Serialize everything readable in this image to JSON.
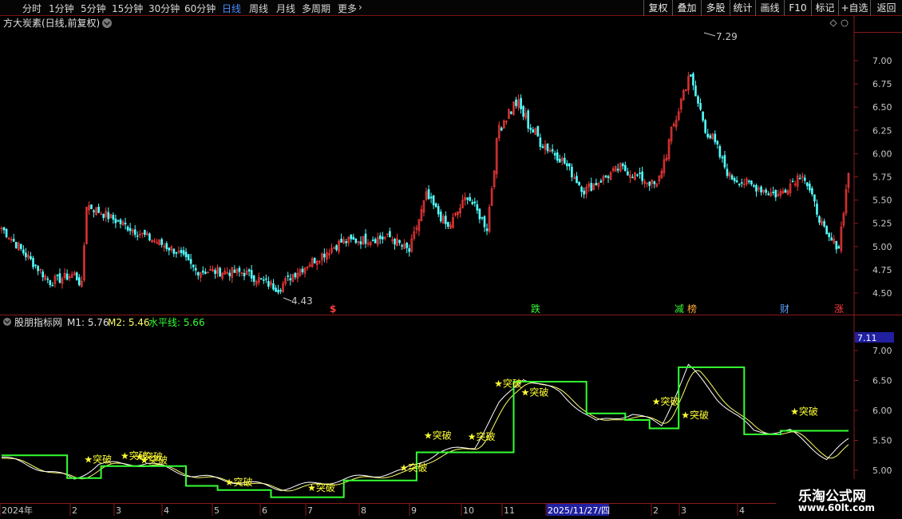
{
  "toolbar": {
    "timeframes": [
      "分时",
      "1分钟",
      "5分钟",
      "15分钟",
      "30分钟",
      "60分钟",
      "日线",
      "周线",
      "月线",
      "多周期",
      "更多"
    ],
    "active_timeframe": "日线",
    "more_chevron": "›",
    "right_buttons": [
      "复权",
      "叠加",
      "多股",
      "统计",
      "画线",
      "F10",
      "标记",
      "+自选",
      "返回"
    ]
  },
  "colors": {
    "up": "#ff3c3c",
    "down": "#54ffff",
    "ma_white": "#ffffff",
    "ma_yellow": "#ffff66",
    "level_green": "#33ff33",
    "signal_star": "#ffff33",
    "border": "#8b1a1a",
    "axis_text": "#c8c8c8",
    "highlight": "#2020a0"
  },
  "main_panel": {
    "title": "方大炭素(日线,前复权)",
    "high_label": "7.29",
    "low_label": "4.43",
    "price_ticks": [
      "7.00",
      "6.75",
      "6.50",
      "6.25",
      "6.00",
      "5.75",
      "5.50",
      "5.25",
      "5.00",
      "4.75",
      "4.50"
    ],
    "event_markers": [
      {
        "label": "$",
        "color": "#ff3c3c"
      },
      {
        "label": "跌",
        "color": "#33ff33"
      },
      {
        "label": "减",
        "color": "#33ff33"
      },
      {
        "label": "榜",
        "color": "#ffaa33"
      },
      {
        "label": "财",
        "color": "#5aa0ff"
      },
      {
        "label": "涨",
        "color": "#ff3c3c"
      }
    ]
  },
  "indicator_panel": {
    "name": "股朋指标网",
    "m1_label": "M1: 5.76",
    "m2_label": "M2: 5.46",
    "level_label": "水平线: 5.66",
    "current_value": "7.11",
    "ticks": [
      "7.00",
      "6.50",
      "6.00",
      "5.50",
      "5.00"
    ],
    "signal_text": "★突破",
    "signal_prices": [
      5.18,
      5.24,
      5.23,
      5.17,
      4.8,
      4.71,
      5.04,
      5.58,
      5.56,
      6.45,
      6.3,
      6.15,
      5.92,
      5.98
    ]
  },
  "date_axis": {
    "labels": [
      "2024年",
      "2",
      "3",
      "4",
      "5",
      "6",
      "7",
      "8",
      "9",
      "10",
      "11",
      "2025/11/27/四",
      "2",
      "3",
      "4"
    ]
  },
  "watermark": {
    "title": "乐淘公式网",
    "url": "www.60lt.com"
  },
  "chart_data": {
    "type": "candlestick",
    "title": "方大炭素(日线,前复权)",
    "ylim": [
      4.4,
      7.35
    ],
    "anchor_points": [
      {
        "i": 0,
        "close": 5.2
      },
      {
        "i": 20,
        "close": 4.62
      },
      {
        "i": 30,
        "close": 4.7
      },
      {
        "i": 33,
        "close": 4.58
      },
      {
        "i": 35,
        "close": 5.45
      },
      {
        "i": 60,
        "close": 5.1
      },
      {
        "i": 72,
        "close": 4.95
      },
      {
        "i": 80,
        "close": 4.74
      },
      {
        "i": 100,
        "close": 4.72
      },
      {
        "i": 114,
        "close": 4.55
      },
      {
        "i": 120,
        "close": 4.7
      },
      {
        "i": 140,
        "close": 5.05
      },
      {
        "i": 160,
        "close": 5.1
      },
      {
        "i": 168,
        "close": 4.95
      },
      {
        "i": 175,
        "close": 5.55
      },
      {
        "i": 184,
        "close": 5.2
      },
      {
        "i": 192,
        "close": 5.55
      },
      {
        "i": 200,
        "close": 5.2
      },
      {
        "i": 205,
        "close": 6.3
      },
      {
        "i": 212,
        "close": 6.55
      },
      {
        "i": 220,
        "close": 6.2
      },
      {
        "i": 232,
        "close": 5.9
      },
      {
        "i": 240,
        "close": 5.6
      },
      {
        "i": 255,
        "close": 5.85
      },
      {
        "i": 270,
        "close": 5.65
      },
      {
        "i": 283,
        "close": 6.85
      },
      {
        "i": 290,
        "close": 6.3
      },
      {
        "i": 300,
        "close": 5.75
      },
      {
        "i": 320,
        "close": 5.55
      },
      {
        "i": 330,
        "close": 5.8
      },
      {
        "i": 340,
        "close": 5.1
      },
      {
        "i": 345,
        "close": 5.0
      },
      {
        "i": 349,
        "close": 5.8
      }
    ],
    "ma_anchor_m1": [
      {
        "i": 0,
        "v": 5.22
      },
      {
        "i": 20,
        "v": 4.98
      },
      {
        "i": 30,
        "v": 4.85
      },
      {
        "i": 40,
        "v": 5.1
      },
      {
        "i": 60,
        "v": 5.12
      },
      {
        "i": 80,
        "v": 4.9
      },
      {
        "i": 100,
        "v": 4.8
      },
      {
        "i": 115,
        "v": 4.7
      },
      {
        "i": 130,
        "v": 4.78
      },
      {
        "i": 150,
        "v": 4.9
      },
      {
        "i": 165,
        "v": 4.98
      },
      {
        "i": 180,
        "v": 5.3
      },
      {
        "i": 195,
        "v": 5.4
      },
      {
        "i": 205,
        "v": 6.1
      },
      {
        "i": 215,
        "v": 6.55
      },
      {
        "i": 230,
        "v": 6.3
      },
      {
        "i": 245,
        "v": 5.8
      },
      {
        "i": 260,
        "v": 5.95
      },
      {
        "i": 272,
        "v": 5.75
      },
      {
        "i": 283,
        "v": 6.75
      },
      {
        "i": 295,
        "v": 6.2
      },
      {
        "i": 310,
        "v": 5.65
      },
      {
        "i": 325,
        "v": 5.65
      },
      {
        "i": 340,
        "v": 5.2
      },
      {
        "i": 349,
        "v": 5.5
      }
    ],
    "level_steps": [
      {
        "start": 0,
        "end": 26,
        "v": 5.25
      },
      {
        "start": 27,
        "end": 40,
        "v": 4.87
      },
      {
        "start": 41,
        "end": 75,
        "v": 5.07
      },
      {
        "start": 76,
        "end": 88,
        "v": 4.74
      },
      {
        "start": 89,
        "end": 110,
        "v": 4.67
      },
      {
        "start": 111,
        "end": 140,
        "v": 4.55
      },
      {
        "start": 141,
        "end": 170,
        "v": 4.83
      },
      {
        "start": 171,
        "end": 210,
        "v": 5.3
      },
      {
        "start": 211,
        "end": 240,
        "v": 6.48
      },
      {
        "start": 241,
        "end": 256,
        "v": 5.95
      },
      {
        "start": 257,
        "end": 266,
        "v": 5.84
      },
      {
        "start": 267,
        "end": 278,
        "v": 5.7
      },
      {
        "start": 279,
        "end": 305,
        "v": 6.72
      },
      {
        "start": 306,
        "end": 320,
        "v": 5.6
      },
      {
        "start": 321,
        "end": 349,
        "v": 5.66
      }
    ]
  }
}
